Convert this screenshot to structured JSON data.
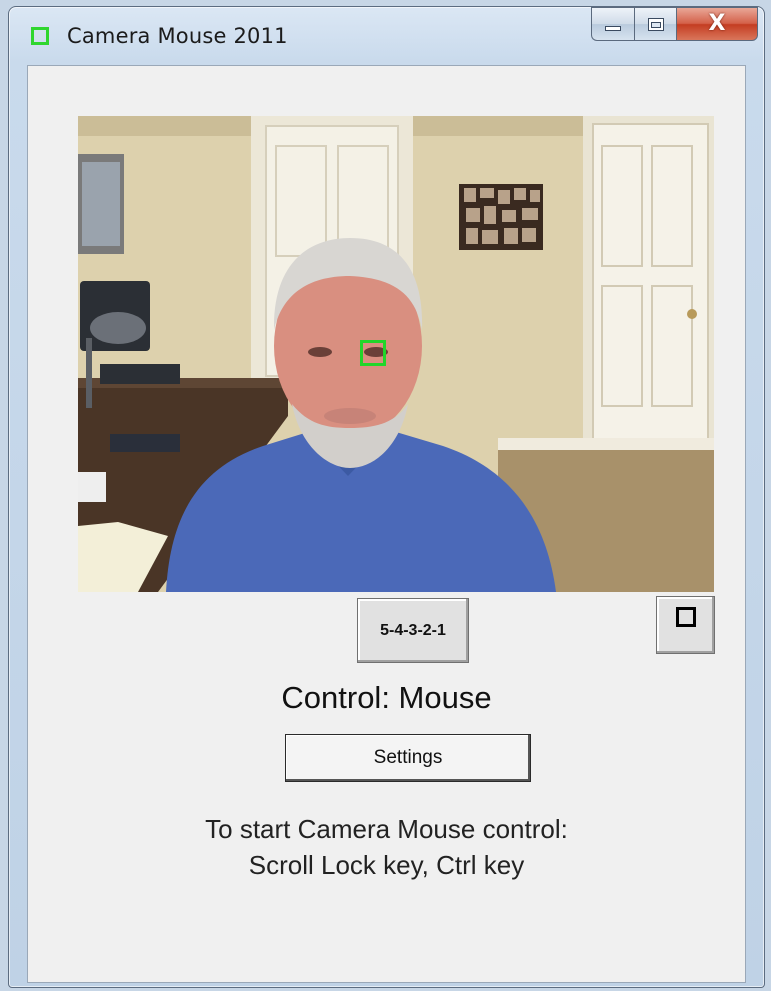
{
  "window": {
    "title": "Camera Mouse 2011",
    "app_icon": "green-square-icon",
    "caption_buttons": [
      "minimize-icon",
      "maximize-icon",
      "close-icon"
    ],
    "close_glyph": "X",
    "accent_color": "#2fd62f"
  },
  "video": {
    "description_icon": "camera-feed",
    "tracking_box_color": "#21d62a"
  },
  "countdown_button": {
    "label": "5-4-3-2-1"
  },
  "window_square_button": {
    "icon": "square-icon"
  },
  "status": {
    "control_text": "Control: Mouse"
  },
  "settings_button": {
    "label": "Settings"
  },
  "instructions": {
    "line1": "To start Camera Mouse control:",
    "line2": "Scroll Lock key, Ctrl key"
  }
}
